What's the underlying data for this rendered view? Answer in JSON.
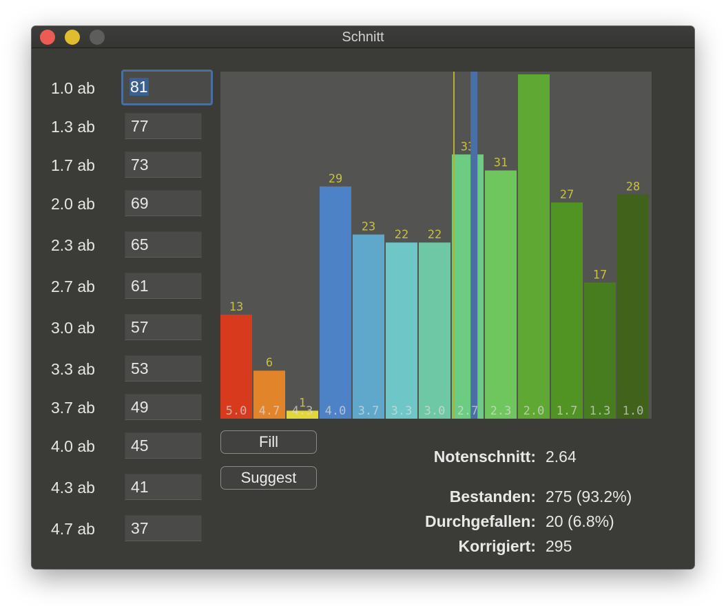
{
  "window": {
    "title": "Schnitt"
  },
  "grade_thresholds": [
    {
      "label": "1.0 ab",
      "value": "81"
    },
    {
      "label": "1.3 ab",
      "value": "77"
    },
    {
      "label": "1.7 ab",
      "value": "73"
    },
    {
      "label": "2.0 ab",
      "value": "69"
    },
    {
      "label": "2.3 ab",
      "value": "65"
    },
    {
      "label": "2.7 ab",
      "value": "61"
    },
    {
      "label": "3.0 ab",
      "value": "57"
    },
    {
      "label": "3.3 ab",
      "value": "53"
    },
    {
      "label": "3.7 ab",
      "value": "49"
    },
    {
      "label": "4.0 ab",
      "value": "45"
    },
    {
      "label": "4.3 ab",
      "value": "41"
    },
    {
      "label": "4.7 ab",
      "value": "37"
    }
  ],
  "buttons": {
    "fill": "Fill",
    "suggest": "Suggest"
  },
  "stats": {
    "average_label": "Notenschnitt:",
    "average_value": "2.64",
    "passed_label": "Bestanden:",
    "passed_value": "275 (93.2%)",
    "failed_label": "Durchgefallen:",
    "failed_value": "20 (6.8%)",
    "graded_label": "Korrigiert:",
    "graded_value": "295"
  },
  "colors": {
    "count_label": "#c8c040",
    "grade_label": "#dcdcdc",
    "marker_thin": "#b8b030",
    "marker_thick": "#4a6fa5"
  },
  "chart_data": {
    "type": "bar",
    "categories": [
      "5.0",
      "4.7",
      "4.3",
      "4.0",
      "3.7",
      "3.3",
      "3.0",
      "2.7",
      "2.3",
      "2.0",
      "1.7",
      "1.3",
      "1.0"
    ],
    "values": [
      13,
      6,
      1,
      29,
      23,
      22,
      22,
      33,
      31,
      43,
      27,
      17,
      28
    ],
    "bar_colors": [
      "#d83a1e",
      "#e2852a",
      "#e2d63a",
      "#4d82c7",
      "#5fa8cb",
      "#6fc6c6",
      "#6ec8a6",
      "#6ccc82",
      "#70c65e",
      "#5fa833",
      "#529424",
      "#487d1f",
      "#40621b"
    ],
    "ylim": [
      0,
      43
    ],
    "average": 2.64,
    "markers": [
      {
        "grade": 2.7,
        "style": "thin"
      },
      {
        "grade": 2.64,
        "style": "thick"
      }
    ],
    "xlabel": "",
    "ylabel": ""
  }
}
